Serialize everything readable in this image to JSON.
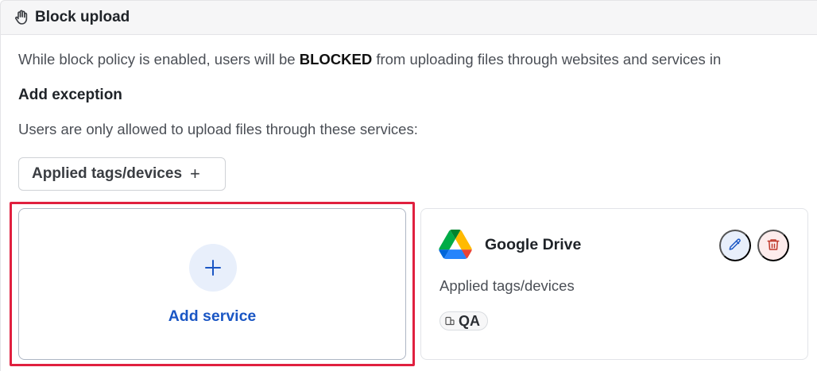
{
  "header": {
    "title": "Block upload",
    "icon": "hand-icon"
  },
  "policy": {
    "description_before": "While block policy is enabled, users will be ",
    "description_bold": "BLOCKED",
    "description_after": " from uploading files through websites and services in",
    "add_exception_heading": "Add exception",
    "allowed_note": "Users are only allowed to upload files through these services:",
    "applied_tags_button": "Applied tags/devices",
    "applied_tags_button_icon": "plus"
  },
  "add_service": {
    "label": "Add service",
    "icon": "+"
  },
  "services": [
    {
      "name": "Google Drive",
      "logo": "google-drive-logo",
      "applied_label": "Applied tags/devices",
      "tags": [
        {
          "label": "QA",
          "icon": "device-icon"
        }
      ]
    }
  ],
  "colors": {
    "accent": "#1a56c4",
    "highlight_border": "#e0203f",
    "delete": "#c0392b",
    "edit_bg": "#e8effb",
    "delete_bg": "#fdecec"
  }
}
